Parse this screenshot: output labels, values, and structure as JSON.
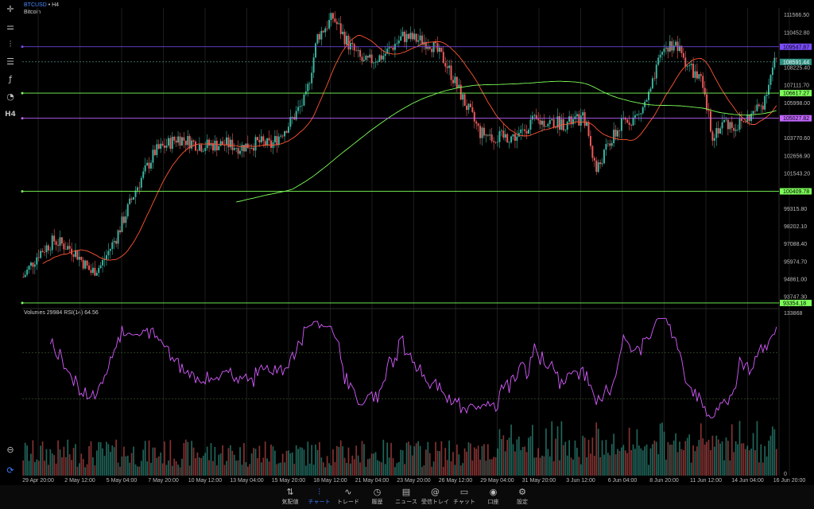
{
  "header": {
    "symbol": "BTCUSD",
    "timeframe": "• H4",
    "name": "Bitcoin"
  },
  "rsi_label": "Volumes 29984 RSI(14) 64.56",
  "toolbar": {
    "icons": [
      "crosshair-icon",
      "candles-icon",
      "indicators-icon",
      "drawing-icon",
      "fibonacci-icon",
      "objects-icon",
      "timeframe-label"
    ],
    "timeframe_label": "H4"
  },
  "nav": [
    {
      "label": "気配値",
      "icon": "quotes-icon"
    },
    {
      "label": "チャート",
      "icon": "chart-icon",
      "active": true
    },
    {
      "label": "トレード",
      "icon": "trade-icon"
    },
    {
      "label": "履歴",
      "icon": "history-icon"
    },
    {
      "label": "ニュース",
      "icon": "news-icon"
    },
    {
      "label": "受信トレイ",
      "icon": "inbox-icon"
    },
    {
      "label": "チャット",
      "icon": "chat-icon"
    },
    {
      "label": "口座",
      "icon": "account-icon"
    },
    {
      "label": "設定",
      "icon": "settings-icon"
    }
  ],
  "chart_data": {
    "type": "candlestick",
    "title": "BTCUSD • H4 Bitcoin",
    "y_ticks": [
      "111566.50",
      "110452.80",
      "109547.87",
      "108591.44",
      "108225.40",
      "107111.70",
      "106617.27",
      "105998.00",
      "105027.82",
      "103770.60",
      "102656.90",
      "101543.20",
      "100409.78",
      "99315.80",
      "98202.10",
      "97088.40",
      "95974.70",
      "94861.00",
      "93747.30",
      "93354.18"
    ],
    "ylim": [
      93300,
      112000
    ],
    "x_ticks": [
      "29 Apr 20:00",
      "2 May 12:00",
      "5 May 04:00",
      "7 May 20:00",
      "10 May 12:00",
      "13 May 04:00",
      "15 May 20:00",
      "18 May 12:00",
      "21 May 04:00",
      "23 May 20:00",
      "26 May 12:00",
      "29 May 04:00",
      "31 May 20:00",
      "3 Jun 12:00",
      "6 Jun 04:00",
      "8 Jun 20:00",
      "11 Jun 12:00",
      "14 Jun 04:00",
      "16 Jun 20:00"
    ],
    "horizontal_lines": [
      {
        "price": 109547.87,
        "color": "#7b4dff",
        "label": "109547.87"
      },
      {
        "price": 106617.27,
        "color": "#7dff5a",
        "label": "106617.27"
      },
      {
        "price": 105027.82,
        "color": "#c266ff",
        "label": "105027.82"
      },
      {
        "price": 100409.78,
        "color": "#7dff5a",
        "label": "100409.78"
      },
      {
        "price": 93354.18,
        "color": "#7dff5a",
        "label": "93354.18"
      }
    ],
    "current_price": {
      "price": 108591.44,
      "label": "108591.44"
    },
    "close_path": [
      [
        0,
        95000
      ],
      [
        8,
        96500
      ],
      [
        16,
        97300
      ],
      [
        26,
        96700
      ],
      [
        35,
        95300
      ],
      [
        40,
        95700
      ],
      [
        48,
        97500
      ],
      [
        58,
        100500
      ],
      [
        68,
        102900
      ],
      [
        80,
        103800
      ],
      [
        92,
        103300
      ],
      [
        105,
        103400
      ],
      [
        112,
        103200
      ],
      [
        122,
        103500
      ],
      [
        128,
        103300
      ],
      [
        138,
        104800
      ],
      [
        146,
        106300
      ],
      [
        152,
        110200
      ],
      [
        160,
        111400
      ],
      [
        168,
        109700
      ],
      [
        176,
        108500
      ],
      [
        186,
        109000
      ],
      [
        196,
        110200
      ],
      [
        210,
        109800
      ],
      [
        218,
        108600
      ],
      [
        228,
        106000
      ],
      [
        236,
        104100
      ],
      [
        244,
        103800
      ],
      [
        256,
        103900
      ],
      [
        262,
        104800
      ],
      [
        270,
        104800
      ],
      [
        280,
        104700
      ],
      [
        290,
        105000
      ],
      [
        296,
        101700
      ],
      [
        302,
        103300
      ],
      [
        310,
        104800
      ],
      [
        318,
        105200
      ],
      [
        324,
        106700
      ],
      [
        330,
        109300
      ],
      [
        336,
        109800
      ],
      [
        344,
        108300
      ],
      [
        350,
        107300
      ],
      [
        356,
        104000
      ],
      [
        362,
        104800
      ],
      [
        368,
        104500
      ],
      [
        376,
        105200
      ],
      [
        382,
        106000
      ],
      [
        388,
        108600
      ]
    ],
    "ma_fast_color": "#ff5533",
    "ma_slow_color": "#7dff5a",
    "rsi": {
      "period": 14,
      "value": 64.56,
      "levels": [
        70,
        30
      ],
      "color": "#d65cff"
    },
    "volume_label": "Volumes 29984",
    "volume_max_tick": "133868",
    "volume_min_tick": "0",
    "up_color": "#3bb6a2",
    "down_color": "#ef5a5a"
  }
}
